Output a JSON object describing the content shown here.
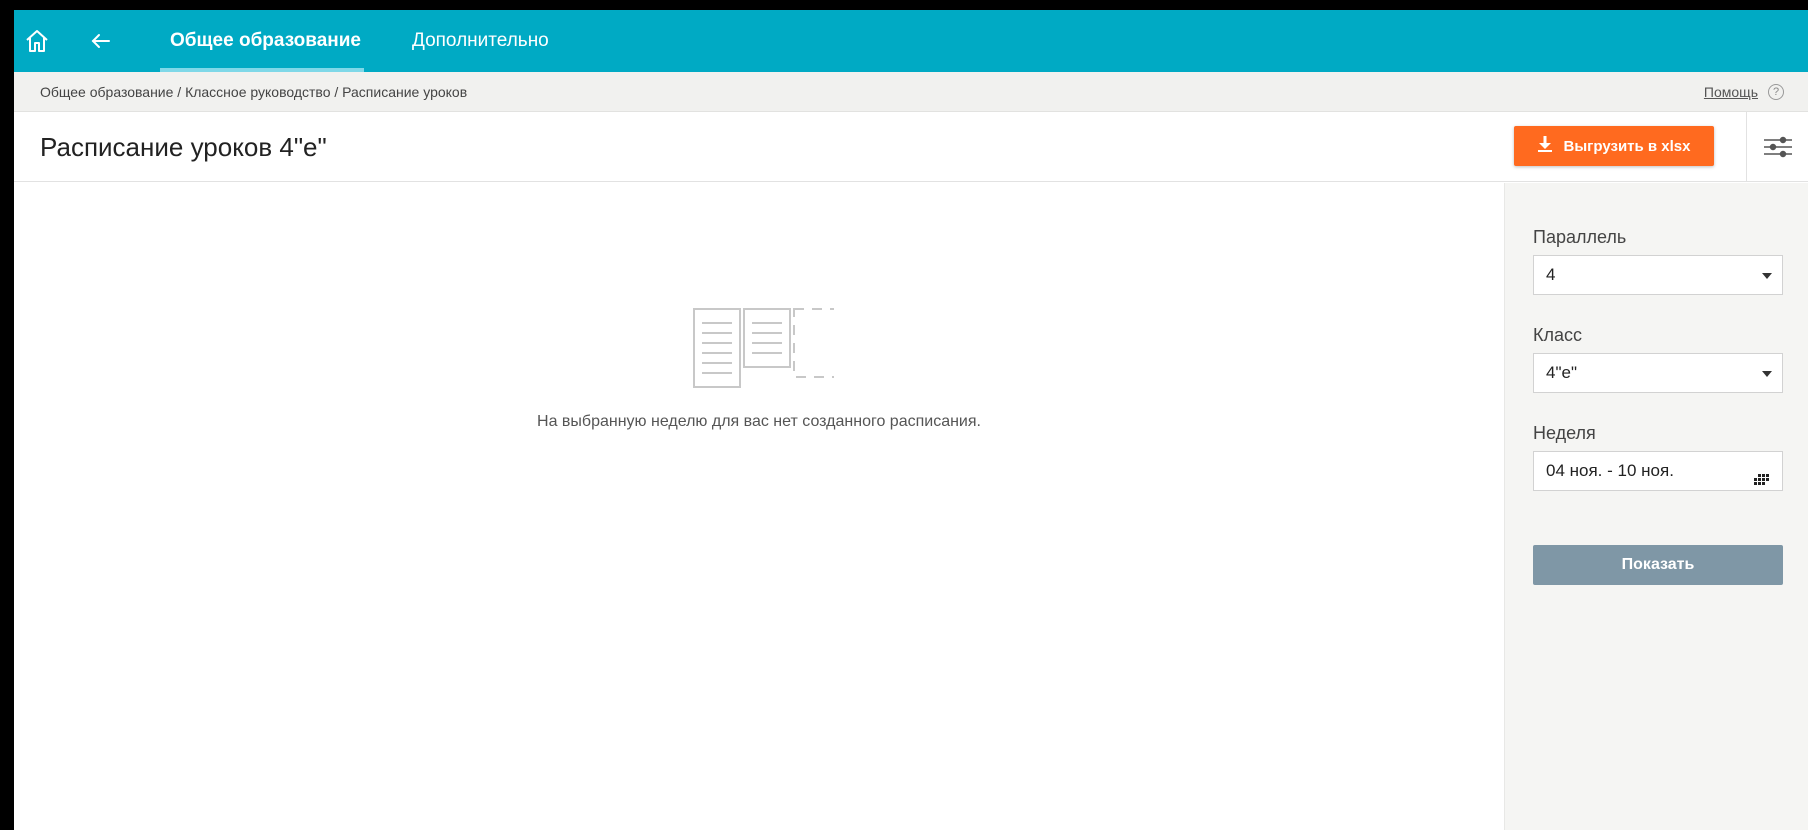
{
  "nav": {
    "tabs": [
      {
        "label": "Общее образование",
        "active": true
      },
      {
        "label": "Дополнительно",
        "active": false
      }
    ],
    "home_icon": "home-icon",
    "back_icon": "arrow-left-icon"
  },
  "breadcrumb": {
    "path": "Общее образование / Классное руководство / Расписание уроков",
    "help_label": "Помощь",
    "help_icon_glyph": "?"
  },
  "page": {
    "title": "Расписание уроков 4\"е\"",
    "export_label": "Выгрузить в xlsx",
    "export_icon": "download-icon",
    "filter_icon": "sliders-icon"
  },
  "main": {
    "empty_message": "На выбранную неделю для вас нет созданного расписания.",
    "empty_icon": "empty-schedule-icon"
  },
  "filters": {
    "parallel_label": "Параллель",
    "parallel_value": "4",
    "class_label": "Класс",
    "class_value": "4\"е\"",
    "week_label": "Неделя",
    "week_value": "04 ноя. - 10 ноя.",
    "week_icon": "calendar-icon",
    "show_label": "Показать"
  },
  "colors": {
    "topbar": "#00aac4",
    "export_button": "#ff6a1f",
    "show_button": "#7f97a6",
    "side_panel": "#f5f5f3"
  }
}
